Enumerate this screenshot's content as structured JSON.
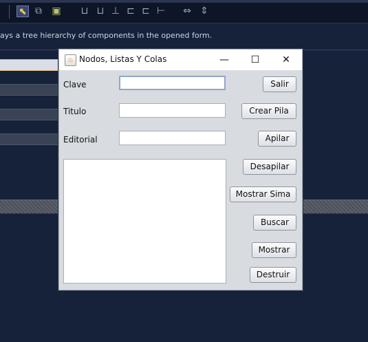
{
  "ide": {
    "hint_text": "ays a tree hierarchy of components in the opened form.",
    "toolbar_icons": [
      "selection-mode-icon",
      "connection-mode-icon",
      "preview-design-icon",
      "align-left-icon",
      "align-right-icon",
      "center-horizontally-icon",
      "align-top-icon",
      "align-bottom-icon",
      "center-vertically-icon",
      "change-horizontal-resizability-icon",
      "change-vertical-resizability-icon"
    ]
  },
  "window": {
    "title": "Nodos, Listas Y Colas",
    "controls": {
      "minimize": "—",
      "maximize": "☐",
      "close": "✕"
    }
  },
  "form": {
    "labels": {
      "clave": "Clave",
      "titulo": "Titulo",
      "editorial": "Editorial"
    },
    "fields": {
      "clave_value": "",
      "titulo_value": "",
      "editorial_value": ""
    },
    "textarea_value": "",
    "buttons": {
      "salir": "Salir",
      "crear_pila": "Crear Pila",
      "apilar": "Apilar",
      "desapilar": "Desapilar",
      "mostrar_sima": "Mostrar Sima",
      "buscar": "Buscar",
      "mostrar": "Mostrar",
      "destruir": "Destruir"
    }
  },
  "colors": {
    "ide_background": "#16213a",
    "window_background": "#d8dbe0",
    "accent_orange": "#d36b12"
  }
}
